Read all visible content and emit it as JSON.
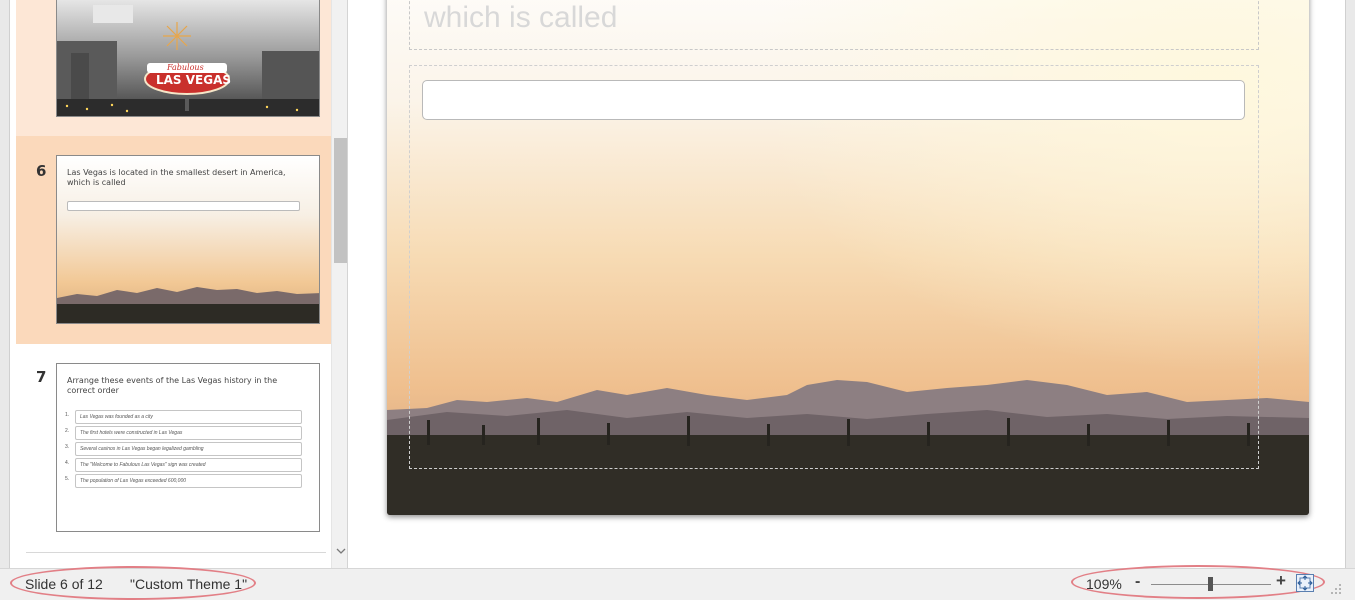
{
  "thumbnails": [
    {
      "number": "",
      "title": "",
      "sign_text": "LAS VEGAS",
      "sign_small": "Fabulous"
    },
    {
      "number": "6",
      "title": "Las Vegas is located in the smallest desert in America, which is called"
    },
    {
      "number": "7",
      "title": "Arrange these events of the Las Vegas history in the correct order",
      "items": [
        {
          "num": "1.",
          "text": "Las Vegas was founded as a city"
        },
        {
          "num": "2.",
          "text": "The first hotels were constructed in Las Vegas"
        },
        {
          "num": "3.",
          "text": "Several casinos in Las Vegas began legalized gambling"
        },
        {
          "num": "4.",
          "text": "The \"Welcome to Fabulous Las Vegas\" sign was created"
        },
        {
          "num": "5.",
          "text": "The population of Las Vegas exceeded 600,000"
        }
      ]
    }
  ],
  "main_slide": {
    "title_visible": "which is called"
  },
  "status_bar": {
    "slide_indicator": "Slide 6 of 12",
    "theme_name": "\"Custom Theme 1\"",
    "zoom_percent": "109%",
    "zoom_minus": "-",
    "zoom_plus": "+",
    "zoom_level": 1.09
  },
  "icons": {
    "scroll_down": "chevron-down-icon",
    "fit_to_window": "fit-slide-icon",
    "resize_grip": "resize-grip-icon"
  },
  "colors": {
    "selected_thumb": "#fbd9bb",
    "annotation_ellipse": "#e27f86"
  }
}
